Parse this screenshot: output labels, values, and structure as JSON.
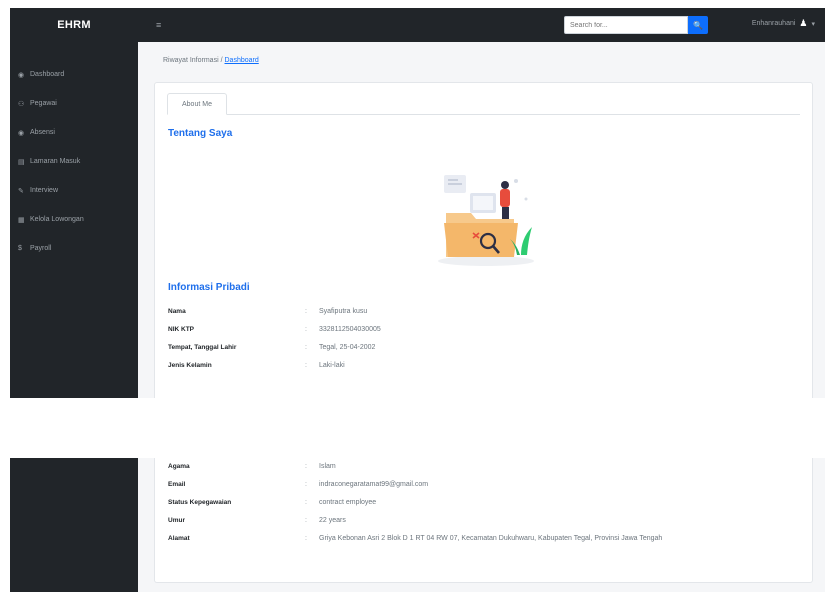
{
  "app": {
    "brand": "EHRM"
  },
  "sidebar": {
    "items": [
      {
        "label": "Dashboard",
        "icon": "dashboard-icon"
      },
      {
        "label": "Pegawai",
        "icon": "users-icon"
      },
      {
        "label": "Absensi",
        "icon": "calendar-icon"
      },
      {
        "label": "Lamaran Masuk",
        "icon": "inbox-icon"
      },
      {
        "label": "Interview",
        "icon": "interview-icon"
      },
      {
        "label": "Kelola Lowongan",
        "icon": "briefcase-icon"
      },
      {
        "label": "Payroll",
        "icon": "money-icon"
      }
    ]
  },
  "topbar": {
    "toggle_icon": "≡",
    "search_placeholder": "Search for...",
    "search_icon": "🔍",
    "user_name": "Enhanrauhani",
    "user_icon": "▾"
  },
  "breadcrumb": {
    "current": "Riwayat Informasi",
    "separator": "/",
    "link": "Dashboard"
  },
  "tabs": {
    "about": "About Me"
  },
  "about": {
    "title": "Tentang Saya"
  },
  "personal": {
    "title": "Informasi Pribadi",
    "rows_top": [
      {
        "label": "Nama",
        "value": "Syafiputra kusu"
      },
      {
        "label": "NIK KTP",
        "value": "3328112504030005"
      },
      {
        "label": "Tempat, Tanggal Lahir",
        "value": "Tegal, 25-04-2002"
      },
      {
        "label": "Jenis Kelamin",
        "value": "Laki-laki"
      }
    ],
    "rows_bottom": [
      {
        "label": "Agama",
        "value": "Islam"
      },
      {
        "label": "Email",
        "value": "indraconegaratamat99@gmail.com"
      },
      {
        "label": "Status Kepegawaian",
        "value": "contract employee"
      },
      {
        "label": "Umur",
        "value": "22 years"
      },
      {
        "label": "Alamat",
        "value": "Griya Kebonan Asri 2 Blok D 1 RT 04 RW 07, Kecamatan Dukuhwaru, Kabupaten Tegal, Provinsi Jawa Tengah"
      }
    ],
    "separator": ":"
  }
}
